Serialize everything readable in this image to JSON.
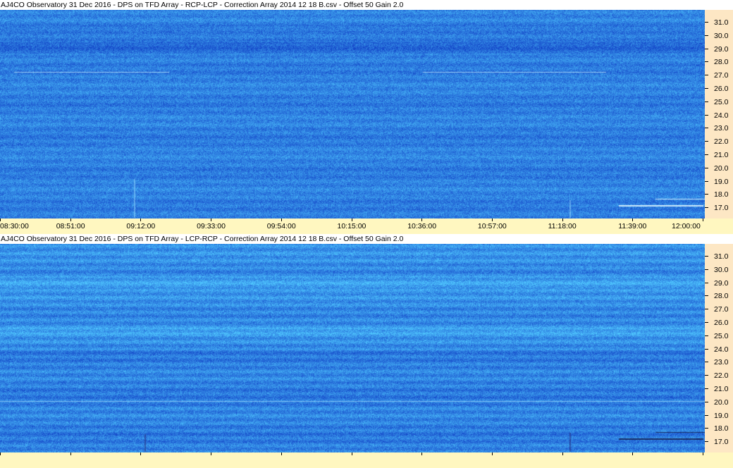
{
  "panels": [
    {
      "title": "AJ4CO Observatory 31 Dec 2016  -  DPS on TFD Array  -  RCP-LCP  -  Correction Array 2014 12 18 B.csv  -  Offset 50  Gain 2.0",
      "channel": "RCP-LCP"
    },
    {
      "title": "AJ4CO Observatory 31 Dec 2016  -  DPS on TFD Array  -  LCP-RCP  -  Correction Array 2014 12 18 B.csv  -  Offset 50  Gain 2.0",
      "channel": "LCP-RCP"
    }
  ],
  "freq_labels": [
    "31.0",
    "30.0",
    "29.0",
    "28.0",
    "27.0",
    "26.0",
    "25.0",
    "24.0",
    "23.0",
    "22.0",
    "21.0",
    "20.0",
    "19.0",
    "18.0",
    "17.0"
  ],
  "time_labels": [
    "08:30:00",
    "08:51:00",
    "09:12:00",
    "09:33:00",
    "09:54:00",
    "10:15:00",
    "10:36:00",
    "10:57:00",
    "11:18:00",
    "11:39:00",
    "12:00:00"
  ],
  "colors": {
    "spectrogram_base": "#2a63e8",
    "spectrogram_bright": "#3aa0f5",
    "spectrogram_dark": "#1a3fc8",
    "freq_axis_bg": "#fde7c4",
    "time_axis_bg": "#fff7c0"
  }
}
